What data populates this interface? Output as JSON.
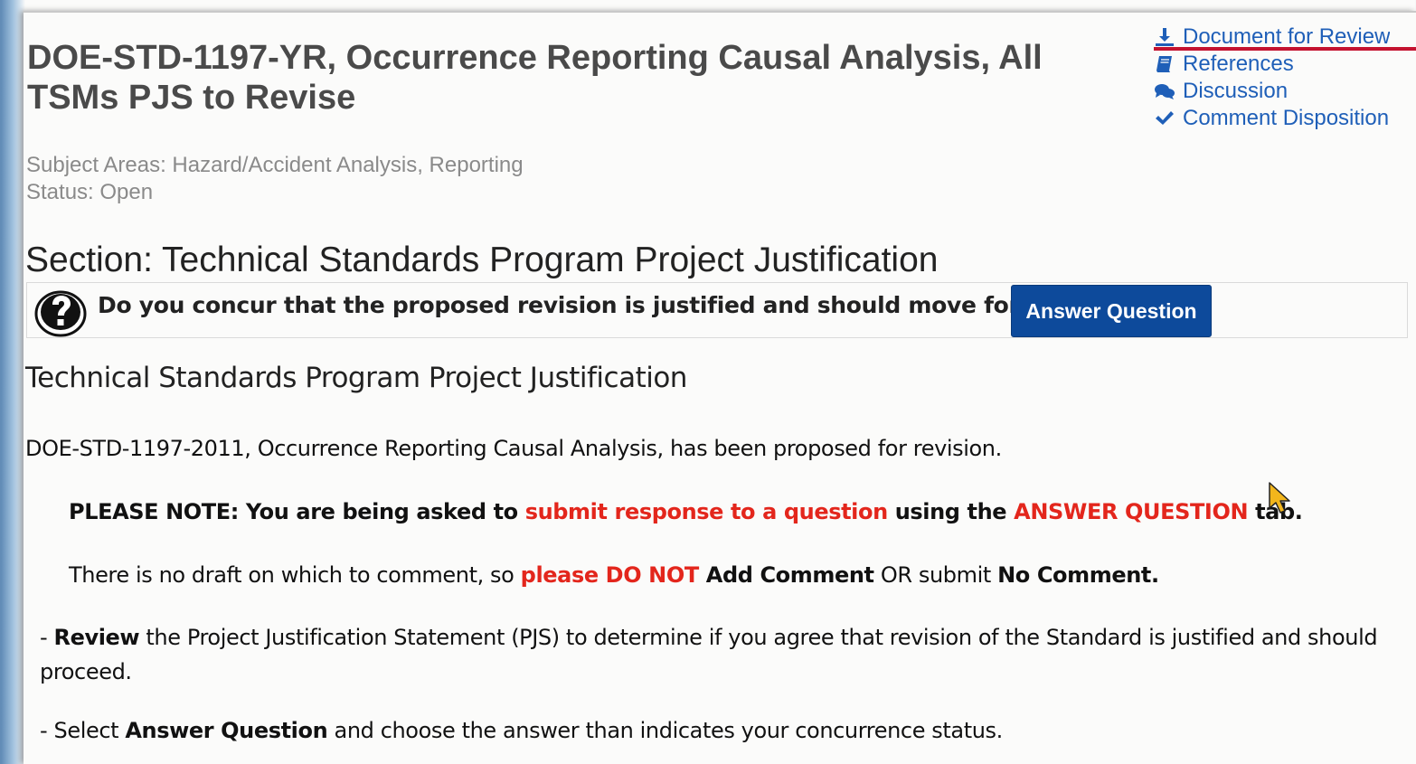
{
  "page": {
    "title": "DOE-STD-1197-YR, Occurrence Reporting Causal Analysis, All TSMs PJS to Revise",
    "subject_areas": "Subject Areas: Hazard/Accident Analysis, Reporting",
    "status": "Status: Open"
  },
  "side_links": [
    {
      "label": "Document for Review",
      "icon": "download-icon"
    },
    {
      "label": "References",
      "icon": "book-icon"
    },
    {
      "label": "Discussion",
      "icon": "comments-icon"
    },
    {
      "label": "Comment Disposition",
      "icon": "checkmark-icon"
    }
  ],
  "section": {
    "heading": "Section: Technical Standards Program Project Justification",
    "question_icon": "question-mark-icon",
    "question_text": "Do you concur that the proposed revision is justified and should move forward?",
    "answer_button_label": "Answer Question"
  },
  "content": {
    "sub_heading": "Technical Standards Program Project Justification",
    "paragraph1": "DOE-STD-1197-2011, Occurrence Reporting Causal Analysis, has been proposed for revision.",
    "note": {
      "part1": "PLEASE NOTE: You are being asked to ",
      "part2": "submit response to a question",
      "part3": " using the ",
      "part4": "ANSWER QUESTION",
      "part5": " tab."
    },
    "draft": {
      "part1": "There is no draft on which to comment, so ",
      "part2": "please DO NOT",
      "part3": " Add Comment",
      "part4": " OR submit ",
      "part5": "No Comment."
    },
    "review": {
      "part1": "- ",
      "part2": "Review",
      "part3": " the Project Justification Statement (PJS) to determine if you agree that revision of the Standard is justified and should proceed."
    },
    "select": {
      "part1": "- Select ",
      "part2": "Answer Question",
      "part3": " and choose the answer than indicates your concurrence status."
    }
  },
  "colors": {
    "link": "#1f5fb8",
    "button": "#0d4a9b",
    "emphasis_red": "#e3261c",
    "underline_red": "#c4122f"
  }
}
